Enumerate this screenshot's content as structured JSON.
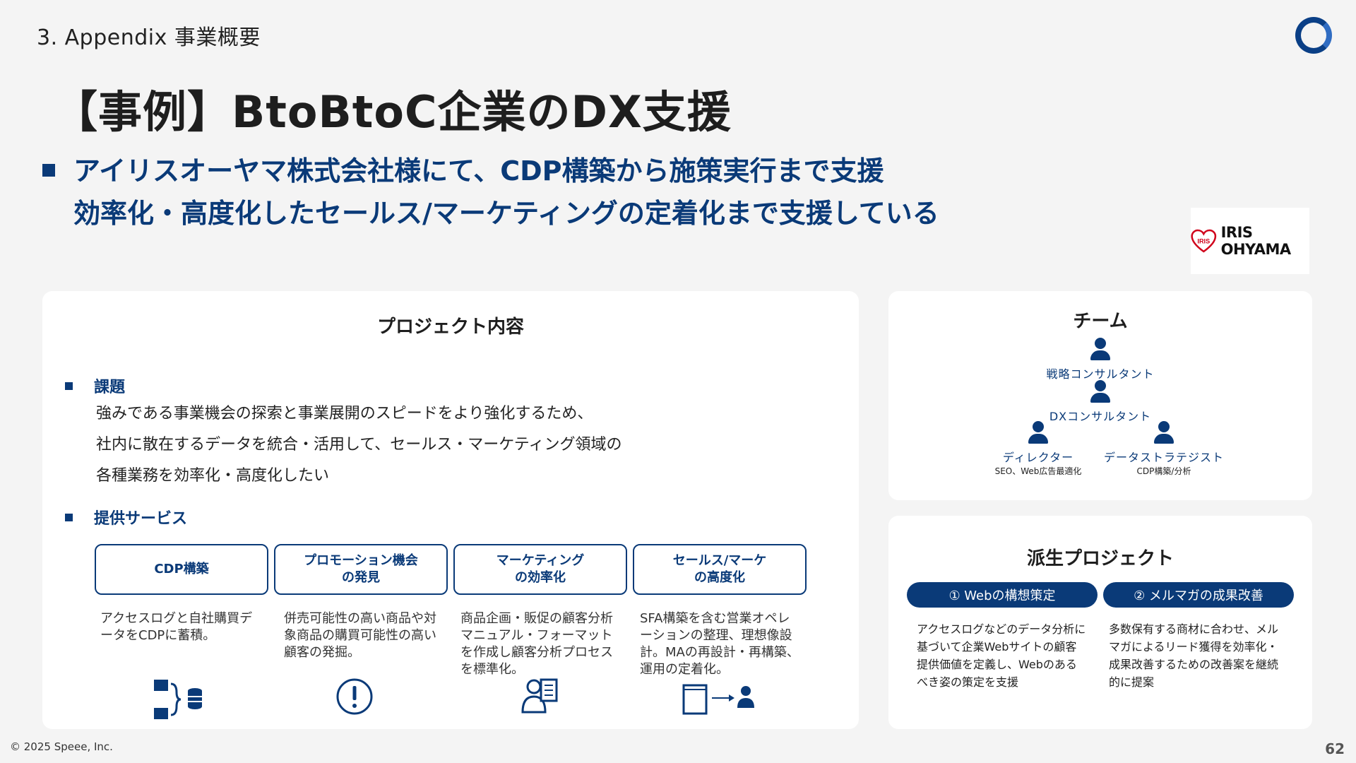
{
  "header": {
    "section_label": "3. Appendix 事業概要",
    "title": "【事例】BtoBtoC企業のDX支援",
    "subtitle_line1": "アイリスオーヤマ株式会社様にて、CDP構築から施策実行まで支援",
    "subtitle_line2": "効率化・高度化したセールス/マーケティングの定着化まで支援している",
    "client_logo_text": "IRIS OHYAMA",
    "client_logo_mark": "IRIS"
  },
  "project": {
    "title": "プロジェクト内容",
    "issue_heading": "課題",
    "issue_lines": [
      "強みである事業機会の探索と事業展開のスピードをより強化するため、",
      "社内に散在するデータを統合・活用して、セールス・マーケティング領域の",
      "各種業務を効率化・高度化したい"
    ],
    "service_heading": "提供サービス",
    "services": [
      {
        "title_line1": "CDP構築",
        "title_line2": "",
        "desc": "アクセスログと自社購買データをCDPに蓄積。",
        "icon": "database-icon"
      },
      {
        "title_line1": "プロモーション機会",
        "title_line2": "の発見",
        "desc": "併売可能性の高い商品や対象商品の購買可能性の高い顧客の発掘。",
        "icon": "exclamation-icon"
      },
      {
        "title_line1": "マーケティング",
        "title_line2": "の効率化",
        "desc": "商品企画・販促の顧客分析マニュアル・フォーマットを作成し顧客分析プロセスを標準化。",
        "icon": "analyst-icon"
      },
      {
        "title_line1": "セールス/マーケ",
        "title_line2": "の高度化",
        "desc": "SFA構築を含む営業オペレーションの整理、理想像設計。MAの再設計・再構築、運用の定着化。",
        "icon": "document-to-person-icon"
      }
    ]
  },
  "team": {
    "title": "チーム",
    "roles": {
      "strategy": "戦略コンサルタント",
      "dx": "DXコンサルタント",
      "director": "ディレクター",
      "director_sub": "SEO、Web広告最適化",
      "strategist": "データストラテジスト",
      "strategist_sub": "CDP構築/分析"
    }
  },
  "derived": {
    "title": "派生プロジェクト",
    "items": [
      {
        "label": "① Webの構想策定",
        "desc": "アクセスログなどのデータ分析に基づいて企業Webサイトの顧客提供価値を定義し、Webのあるべき姿の策定を支援"
      },
      {
        "label": "② メルマガの成果改善",
        "desc": "多数保有する商材に合わせ、メルマガによるリード獲得を効率化・成果改善するための改善案を継続的に提案"
      }
    ]
  },
  "footer": {
    "copyright": "© 2025 Speee, Inc.",
    "page_number": "62"
  },
  "colors": {
    "brand_navy": "#0a3a78",
    "background": "#f4f4f4",
    "card": "#ffffff",
    "iris_red": "#d0021b"
  }
}
